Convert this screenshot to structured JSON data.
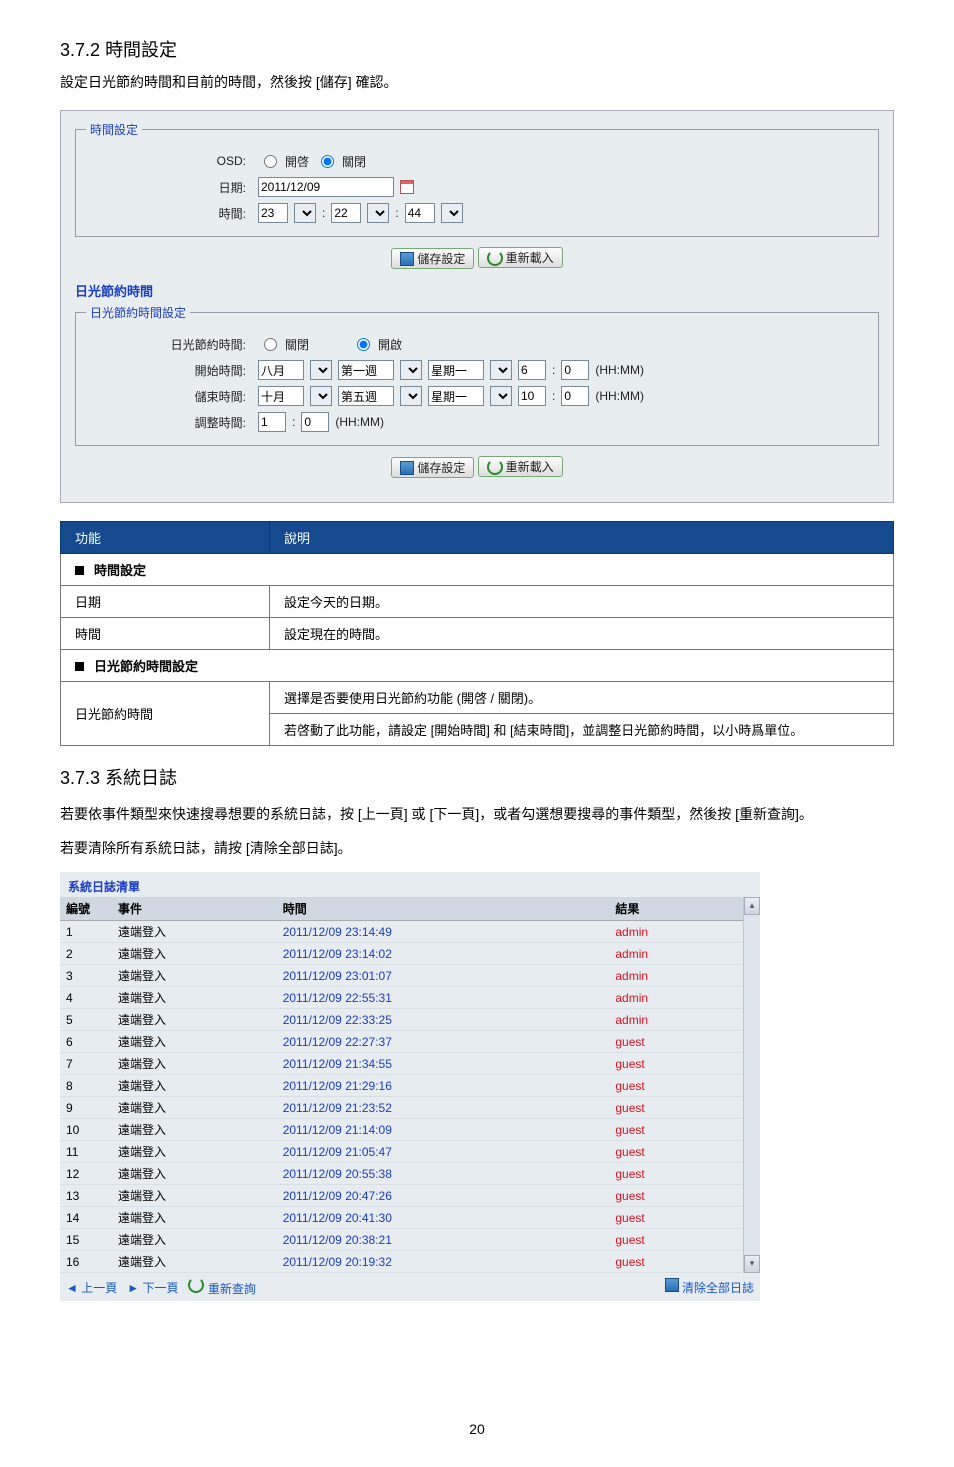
{
  "sec1": {
    "num": "3.7.2",
    "title": "時間設定",
    "intro_a": "設定日光節約時間和目前的時間，然後按",
    "save_word": "[儲存]",
    "intro_b": "確認。"
  },
  "timebox": {
    "legend": "時間設定",
    "osd": "OSD:",
    "osd_on": "開啓",
    "osd_off": "關閉",
    "date_lbl": "日期:",
    "date_val": "2011/12/09",
    "time_lbl": "時間:",
    "hh": "23",
    "mm": "22",
    "ss": "44",
    "colon": ":"
  },
  "buttons": {
    "save": "儲存設定",
    "reload": "重新載入"
  },
  "dst_head": "日光節約時間",
  "dst": {
    "legend": "日光節約時間設定",
    "en_lbl": "日光節約時間:",
    "en_off": "關閉",
    "en_on": "開啟",
    "start_lbl": "開始時間:",
    "start_mon": "八月",
    "start_wk": "第一週",
    "start_day": "星期一",
    "start_hh": "6",
    "start_mm": "0",
    "end_lbl": "儲束時間:",
    "end_mon": "十月",
    "end_wk": "第五週",
    "end_day": "星期一",
    "end_hh": "10",
    "end_mm": "0",
    "adj_lbl": "調整時間:",
    "adj_hh": "1",
    "adj_mm": "0",
    "hhmm": "(HH:MM)"
  },
  "tbl": {
    "h1": "功能",
    "h2": "說明",
    "cat1": "時間設定",
    "r1a": "日期",
    "r1b": "設定今天的日期。",
    "r2a": "時間",
    "r2b": "設定現在的時間。",
    "cat2": "日光節約時間設定",
    "r3a": "日光節約時間",
    "r3b": "選擇是否要使用日光節約功能 (開啓 / 關閉)。",
    "r4": "若啓動了此功能，請設定 [開始時間] 和 [結束時間]，並調整日光節約時間，以小時爲單位。"
  },
  "sec2": {
    "num": "3.7.3",
    "title": "系統日誌",
    "p1": "若要依事件類型來快速搜尋想要的系統日誌，按 [上一頁] 或 [下一頁]，或者勾選想要搜尋的事件類型，然後按 [重新查詢]。",
    "p2": "若要清除所有系統日誌，請按 [清除全部日誌]。"
  },
  "loglist": {
    "title": "系統日誌清單",
    "h_no": "編號",
    "h_ev": "事件",
    "h_time": "時間",
    "h_res": "結果",
    "prev": "上一頁",
    "next": "下一頁",
    "requery": "重新查詢",
    "clear": "清除全部日誌",
    "rows": [
      {
        "n": "1",
        "e": "遠端登入",
        "t": "2011/12/09 23:14:49",
        "r": "admin"
      },
      {
        "n": "2",
        "e": "遠端登入",
        "t": "2011/12/09 23:14:02",
        "r": "admin"
      },
      {
        "n": "3",
        "e": "遠端登入",
        "t": "2011/12/09 23:01:07",
        "r": "admin"
      },
      {
        "n": "4",
        "e": "遠端登入",
        "t": "2011/12/09 22:55:31",
        "r": "admin"
      },
      {
        "n": "5",
        "e": "遠端登入",
        "t": "2011/12/09 22:33:25",
        "r": "admin"
      },
      {
        "n": "6",
        "e": "遠端登入",
        "t": "2011/12/09 22:27:37",
        "r": "guest"
      },
      {
        "n": "7",
        "e": "遠端登入",
        "t": "2011/12/09 21:34:55",
        "r": "guest"
      },
      {
        "n": "8",
        "e": "遠端登入",
        "t": "2011/12/09 21:29:16",
        "r": "guest"
      },
      {
        "n": "9",
        "e": "遠端登入",
        "t": "2011/12/09 21:23:52",
        "r": "guest"
      },
      {
        "n": "10",
        "e": "遠端登入",
        "t": "2011/12/09 21:14:09",
        "r": "guest"
      },
      {
        "n": "11",
        "e": "遠端登入",
        "t": "2011/12/09 21:05:47",
        "r": "guest"
      },
      {
        "n": "12",
        "e": "遠端登入",
        "t": "2011/12/09 20:55:38",
        "r": "guest"
      },
      {
        "n": "13",
        "e": "遠端登入",
        "t": "2011/12/09 20:47:26",
        "r": "guest"
      },
      {
        "n": "14",
        "e": "遠端登入",
        "t": "2011/12/09 20:41:30",
        "r": "guest"
      },
      {
        "n": "15",
        "e": "遠端登入",
        "t": "2011/12/09 20:38:21",
        "r": "guest"
      },
      {
        "n": "16",
        "e": "遠端登入",
        "t": "2011/12/09 20:19:32",
        "r": "guest"
      }
    ]
  },
  "page": "20"
}
